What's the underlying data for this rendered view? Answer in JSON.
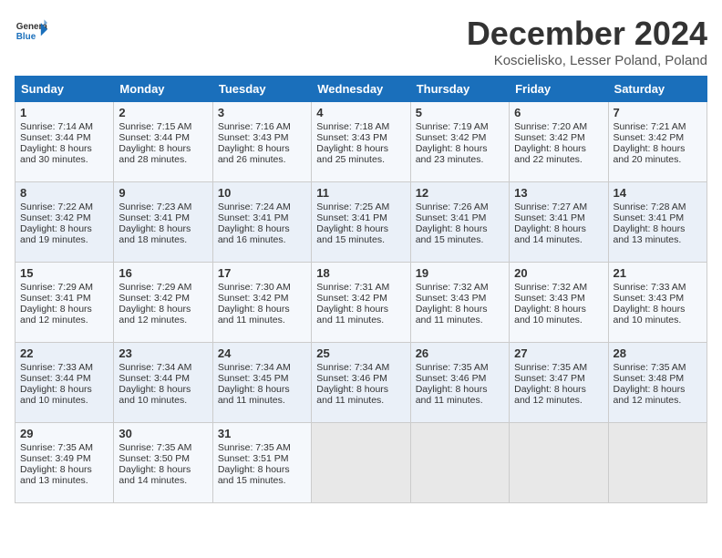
{
  "header": {
    "logo_general": "General",
    "logo_blue": "Blue",
    "title": "December 2024",
    "location": "Koscielisko, Lesser Poland, Poland"
  },
  "weekdays": [
    "Sunday",
    "Monday",
    "Tuesday",
    "Wednesday",
    "Thursday",
    "Friday",
    "Saturday"
  ],
  "weeks": [
    [
      {
        "day": "1",
        "lines": [
          "Sunrise: 7:14 AM",
          "Sunset: 3:44 PM",
          "Daylight: 8 hours",
          "and 30 minutes."
        ]
      },
      {
        "day": "2",
        "lines": [
          "Sunrise: 7:15 AM",
          "Sunset: 3:44 PM",
          "Daylight: 8 hours",
          "and 28 minutes."
        ]
      },
      {
        "day": "3",
        "lines": [
          "Sunrise: 7:16 AM",
          "Sunset: 3:43 PM",
          "Daylight: 8 hours",
          "and 26 minutes."
        ]
      },
      {
        "day": "4",
        "lines": [
          "Sunrise: 7:18 AM",
          "Sunset: 3:43 PM",
          "Daylight: 8 hours",
          "and 25 minutes."
        ]
      },
      {
        "day": "5",
        "lines": [
          "Sunrise: 7:19 AM",
          "Sunset: 3:42 PM",
          "Daylight: 8 hours",
          "and 23 minutes."
        ]
      },
      {
        "day": "6",
        "lines": [
          "Sunrise: 7:20 AM",
          "Sunset: 3:42 PM",
          "Daylight: 8 hours",
          "and 22 minutes."
        ]
      },
      {
        "day": "7",
        "lines": [
          "Sunrise: 7:21 AM",
          "Sunset: 3:42 PM",
          "Daylight: 8 hours",
          "and 20 minutes."
        ]
      }
    ],
    [
      {
        "day": "8",
        "lines": [
          "Sunrise: 7:22 AM",
          "Sunset: 3:42 PM",
          "Daylight: 8 hours",
          "and 19 minutes."
        ]
      },
      {
        "day": "9",
        "lines": [
          "Sunrise: 7:23 AM",
          "Sunset: 3:41 PM",
          "Daylight: 8 hours",
          "and 18 minutes."
        ]
      },
      {
        "day": "10",
        "lines": [
          "Sunrise: 7:24 AM",
          "Sunset: 3:41 PM",
          "Daylight: 8 hours",
          "and 16 minutes."
        ]
      },
      {
        "day": "11",
        "lines": [
          "Sunrise: 7:25 AM",
          "Sunset: 3:41 PM",
          "Daylight: 8 hours",
          "and 15 minutes."
        ]
      },
      {
        "day": "12",
        "lines": [
          "Sunrise: 7:26 AM",
          "Sunset: 3:41 PM",
          "Daylight: 8 hours",
          "and 15 minutes."
        ]
      },
      {
        "day": "13",
        "lines": [
          "Sunrise: 7:27 AM",
          "Sunset: 3:41 PM",
          "Daylight: 8 hours",
          "and 14 minutes."
        ]
      },
      {
        "day": "14",
        "lines": [
          "Sunrise: 7:28 AM",
          "Sunset: 3:41 PM",
          "Daylight: 8 hours",
          "and 13 minutes."
        ]
      }
    ],
    [
      {
        "day": "15",
        "lines": [
          "Sunrise: 7:29 AM",
          "Sunset: 3:41 PM",
          "Daylight: 8 hours",
          "and 12 minutes."
        ]
      },
      {
        "day": "16",
        "lines": [
          "Sunrise: 7:29 AM",
          "Sunset: 3:42 PM",
          "Daylight: 8 hours",
          "and 12 minutes."
        ]
      },
      {
        "day": "17",
        "lines": [
          "Sunrise: 7:30 AM",
          "Sunset: 3:42 PM",
          "Daylight: 8 hours",
          "and 11 minutes."
        ]
      },
      {
        "day": "18",
        "lines": [
          "Sunrise: 7:31 AM",
          "Sunset: 3:42 PM",
          "Daylight: 8 hours",
          "and 11 minutes."
        ]
      },
      {
        "day": "19",
        "lines": [
          "Sunrise: 7:32 AM",
          "Sunset: 3:43 PM",
          "Daylight: 8 hours",
          "and 11 minutes."
        ]
      },
      {
        "day": "20",
        "lines": [
          "Sunrise: 7:32 AM",
          "Sunset: 3:43 PM",
          "Daylight: 8 hours",
          "and 10 minutes."
        ]
      },
      {
        "day": "21",
        "lines": [
          "Sunrise: 7:33 AM",
          "Sunset: 3:43 PM",
          "Daylight: 8 hours",
          "and 10 minutes."
        ]
      }
    ],
    [
      {
        "day": "22",
        "lines": [
          "Sunrise: 7:33 AM",
          "Sunset: 3:44 PM",
          "Daylight: 8 hours",
          "and 10 minutes."
        ]
      },
      {
        "day": "23",
        "lines": [
          "Sunrise: 7:34 AM",
          "Sunset: 3:44 PM",
          "Daylight: 8 hours",
          "and 10 minutes."
        ]
      },
      {
        "day": "24",
        "lines": [
          "Sunrise: 7:34 AM",
          "Sunset: 3:45 PM",
          "Daylight: 8 hours",
          "and 11 minutes."
        ]
      },
      {
        "day": "25",
        "lines": [
          "Sunrise: 7:34 AM",
          "Sunset: 3:46 PM",
          "Daylight: 8 hours",
          "and 11 minutes."
        ]
      },
      {
        "day": "26",
        "lines": [
          "Sunrise: 7:35 AM",
          "Sunset: 3:46 PM",
          "Daylight: 8 hours",
          "and 11 minutes."
        ]
      },
      {
        "day": "27",
        "lines": [
          "Sunrise: 7:35 AM",
          "Sunset: 3:47 PM",
          "Daylight: 8 hours",
          "and 12 minutes."
        ]
      },
      {
        "day": "28",
        "lines": [
          "Sunrise: 7:35 AM",
          "Sunset: 3:48 PM",
          "Daylight: 8 hours",
          "and 12 minutes."
        ]
      }
    ],
    [
      {
        "day": "29",
        "lines": [
          "Sunrise: 7:35 AM",
          "Sunset: 3:49 PM",
          "Daylight: 8 hours",
          "and 13 minutes."
        ]
      },
      {
        "day": "30",
        "lines": [
          "Sunrise: 7:35 AM",
          "Sunset: 3:50 PM",
          "Daylight: 8 hours",
          "and 14 minutes."
        ]
      },
      {
        "day": "31",
        "lines": [
          "Sunrise: 7:35 AM",
          "Sunset: 3:51 PM",
          "Daylight: 8 hours",
          "and 15 minutes."
        ]
      },
      {
        "day": "",
        "lines": []
      },
      {
        "day": "",
        "lines": []
      },
      {
        "day": "",
        "lines": []
      },
      {
        "day": "",
        "lines": []
      }
    ]
  ]
}
